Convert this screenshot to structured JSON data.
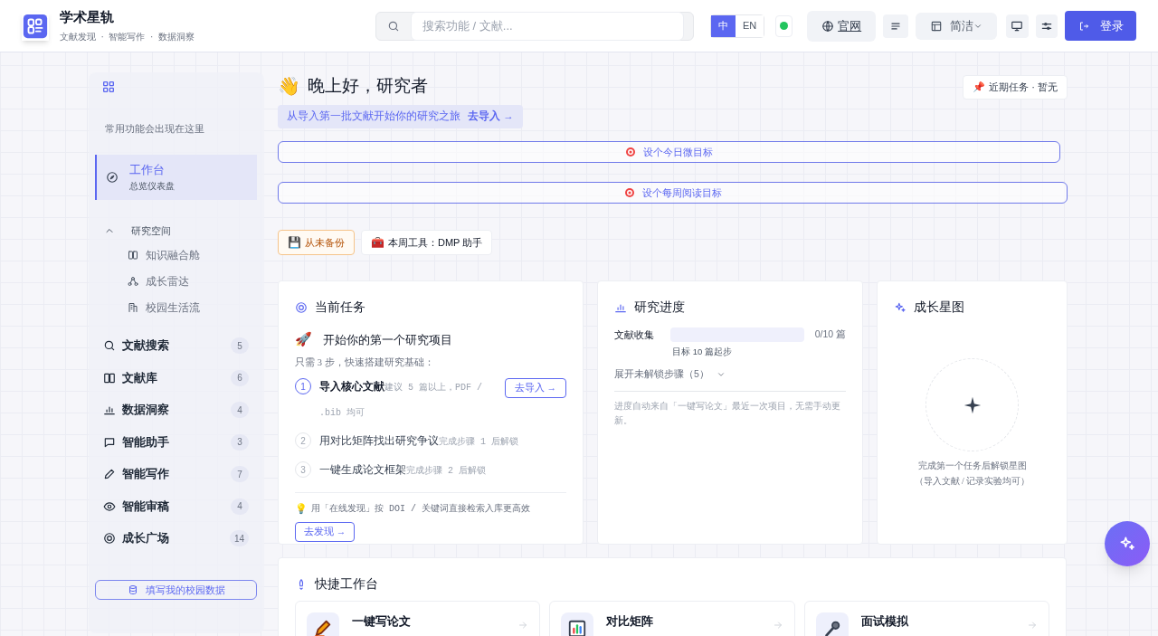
{
  "header": {
    "title": "学术星轨",
    "subtitle": "文献发现  ·  智能写作  ·  数据洞察",
    "search": {
      "placeholder": "搜索功能 / 文献..."
    },
    "languages": [
      {
        "label": "中",
        "selected": true
      },
      {
        "label": "EN",
        "selected": false
      }
    ],
    "website": "官网",
    "layout": "简洁",
    "login": "登录"
  },
  "sidebar": {
    "hint": "常用功能会出现在这里",
    "active": {
      "title": "工作台",
      "subtitle": "总览仪表盘",
      "selected": true
    },
    "group": {
      "label": "研究空间",
      "expanded": true,
      "children": [
        {
          "label": "知识融合舱"
        },
        {
          "label": "成长雷达"
        },
        {
          "label": "校园生活流"
        }
      ]
    },
    "items": [
      {
        "label": "文献搜索",
        "count": "5"
      },
      {
        "label": "文献库",
        "count": "6"
      },
      {
        "label": "数据洞察",
        "count": "4"
      },
      {
        "label": "智能助手",
        "count": "3"
      },
      {
        "label": "智能写作",
        "count": "7"
      },
      {
        "label": "智能审稿",
        "count": "4"
      },
      {
        "label": "成长广场",
        "count": "14"
      }
    ],
    "campus_button": "填写我的校园数据"
  },
  "greeting": {
    "emoji": "👋",
    "title": "晚上好，研究者",
    "banner": "从导入第一批文献开始你的研究之旅",
    "banner_link": "去导入 →",
    "recent_icon": "📌",
    "recent": "近期任务 · 暂无"
  },
  "goals": [
    "设个今日微目标",
    "设个每周阅读目标"
  ],
  "chips": [
    {
      "kind": "warning",
      "icon": "💾",
      "label": "从未备份"
    },
    {
      "kind": "plain",
      "icon": "🧰",
      "label": "本周工具：DMP 助手"
    }
  ],
  "task_card": {
    "title": "当前任务",
    "project_icon": "🚀",
    "project": "开始你的第一个研究项目",
    "intro": "只需 3 步，快速搭建研究基础：",
    "steps": [
      {
        "number": "1",
        "title": "导入核心文献",
        "note": "建议 5 篇以上，PDF / .bib 均可",
        "active": true,
        "action": "去导入 →"
      },
      {
        "number": "2",
        "title": "用对比矩阵找出研究争议",
        "note": "完成步骤 1 后解锁",
        "active": false
      },
      {
        "number": "3",
        "title": "一键生成论文框架",
        "note": "完成步骤 2 后解锁",
        "active": false
      }
    ],
    "tip_icon": "💡",
    "tip": "用「在线发现」按 DOI / 关键词直接检索入库更高效",
    "tip_action": "去发现 →"
  },
  "progress_card": {
    "title": "研究进度",
    "metric": {
      "label": "文献收集",
      "level": 0,
      "reading": "0/10 篇",
      "goal": "目标 10 篇起步"
    },
    "expand": "展开未解锁步骤（5）",
    "note": "进度自动来自「一键写论文」最近一次项目，无需手动更新。"
  },
  "star_card": {
    "title": "成长星图",
    "empty_text": "完成第一个任务后解锁星图",
    "empty_hint": "（导入文献 / 记录实验均可）"
  },
  "quick": {
    "title": "快捷工作台",
    "tiles": [
      {
        "title": "一键写论文"
      },
      {
        "title": "对比矩阵"
      },
      {
        "title": "面试模拟"
      }
    ]
  }
}
